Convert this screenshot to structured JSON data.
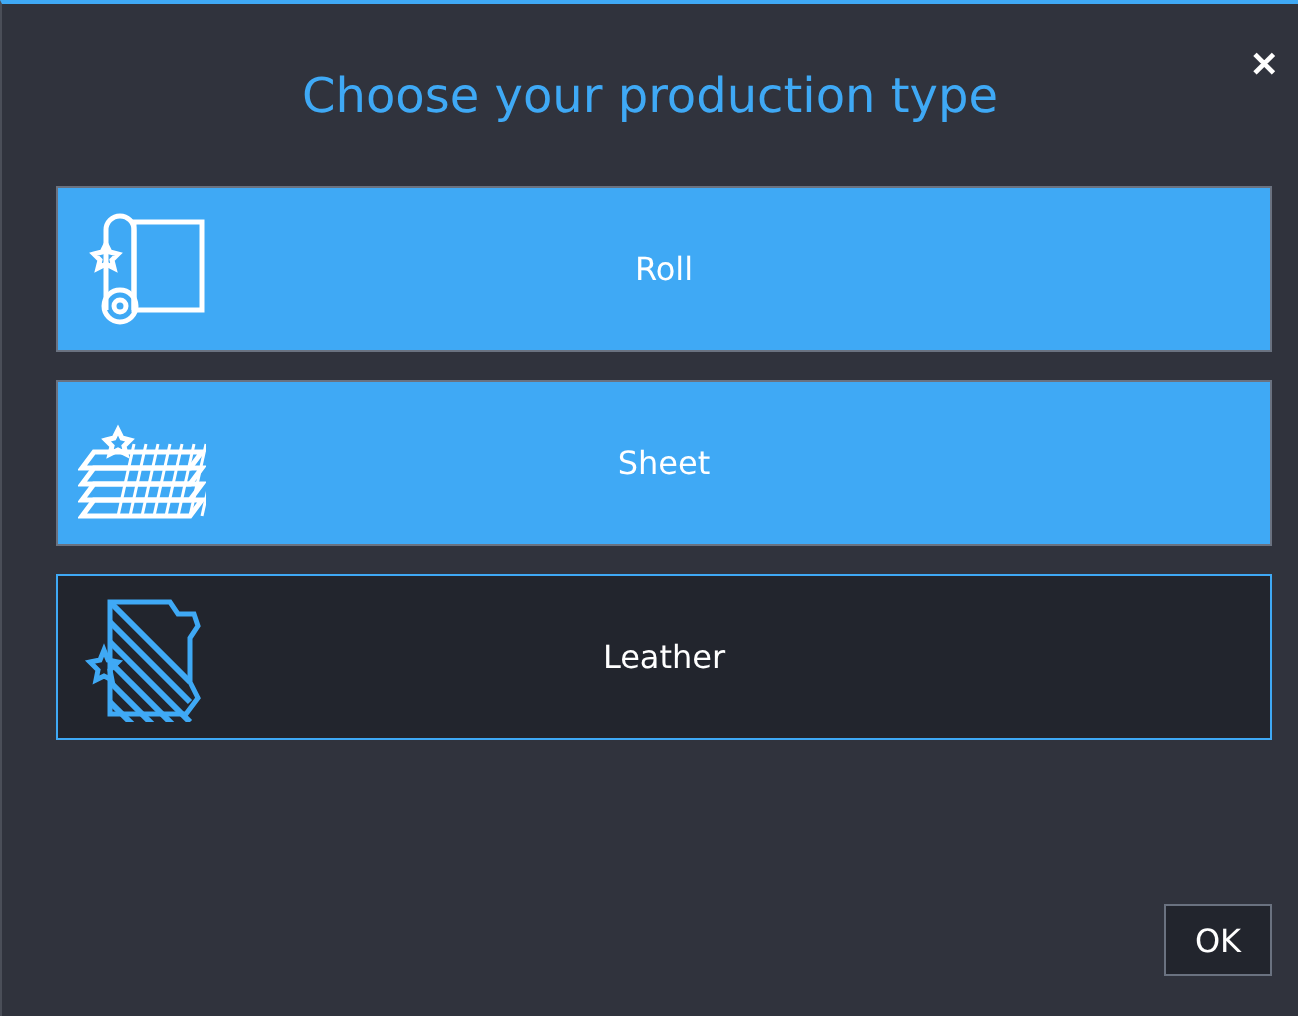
{
  "dialog": {
    "title": "Choose your production type",
    "close": "✕"
  },
  "options": [
    {
      "kind": "roll",
      "label": "Roll",
      "selected": false
    },
    {
      "kind": "sheet",
      "label": "Sheet",
      "selected": false
    },
    {
      "kind": "leather",
      "label": "Leather",
      "selected": true
    }
  ],
  "buttons": [
    "OK"
  ]
}
